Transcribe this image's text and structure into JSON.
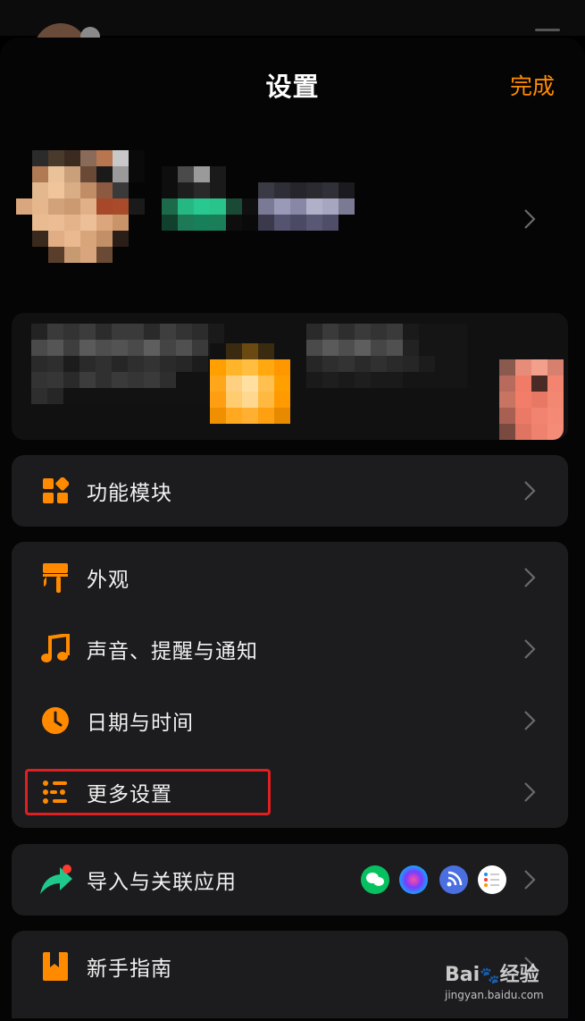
{
  "header": {
    "title": "设置",
    "done_label": "完成"
  },
  "menu": {
    "modules": "功能模块",
    "appearance": "外观",
    "sound": "声音、提醒与通知",
    "datetime": "日期与时间",
    "more": "更多设置",
    "import": "导入与关联应用",
    "guide": "新手指南"
  },
  "icons": {
    "modules": "grid-icon",
    "appearance": "paint-roller-icon",
    "sound": "music-note-icon",
    "datetime": "clock-icon",
    "more": "list-settings-icon",
    "import": "share-arrow-icon",
    "guide": "bookmark-icon"
  },
  "colors": {
    "accent": "#ff8a00",
    "highlight": "#e02020",
    "card": "#1c1c1e"
  },
  "watermark": {
    "brand": "Bai",
    "brand2": "经验",
    "url": "jingyan.baidu.com"
  }
}
